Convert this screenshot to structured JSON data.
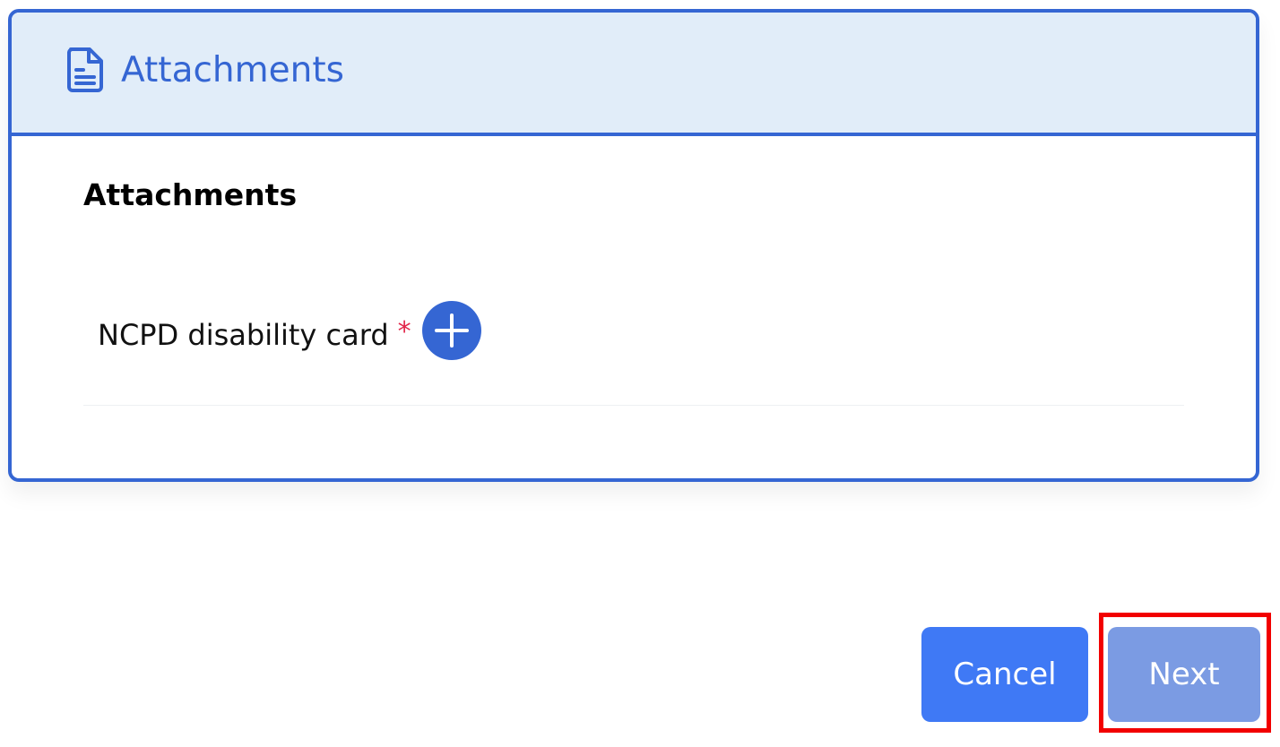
{
  "panel": {
    "header_title": "Attachments",
    "header_icon": "document-icon",
    "section_title": "Attachments"
  },
  "attachments": [
    {
      "label": "NCPD disability card",
      "required_mark": "*",
      "add_icon": "plus-icon"
    }
  ],
  "actions": {
    "cancel_label": "Cancel",
    "next_label": "Next"
  },
  "colors": {
    "primary": "#3566d3",
    "header_bg": "#e1edf9",
    "cancel_bg": "#3f79f5",
    "next_bg": "#7b9be3",
    "required": "#e2264a",
    "highlight": "#f20000"
  }
}
